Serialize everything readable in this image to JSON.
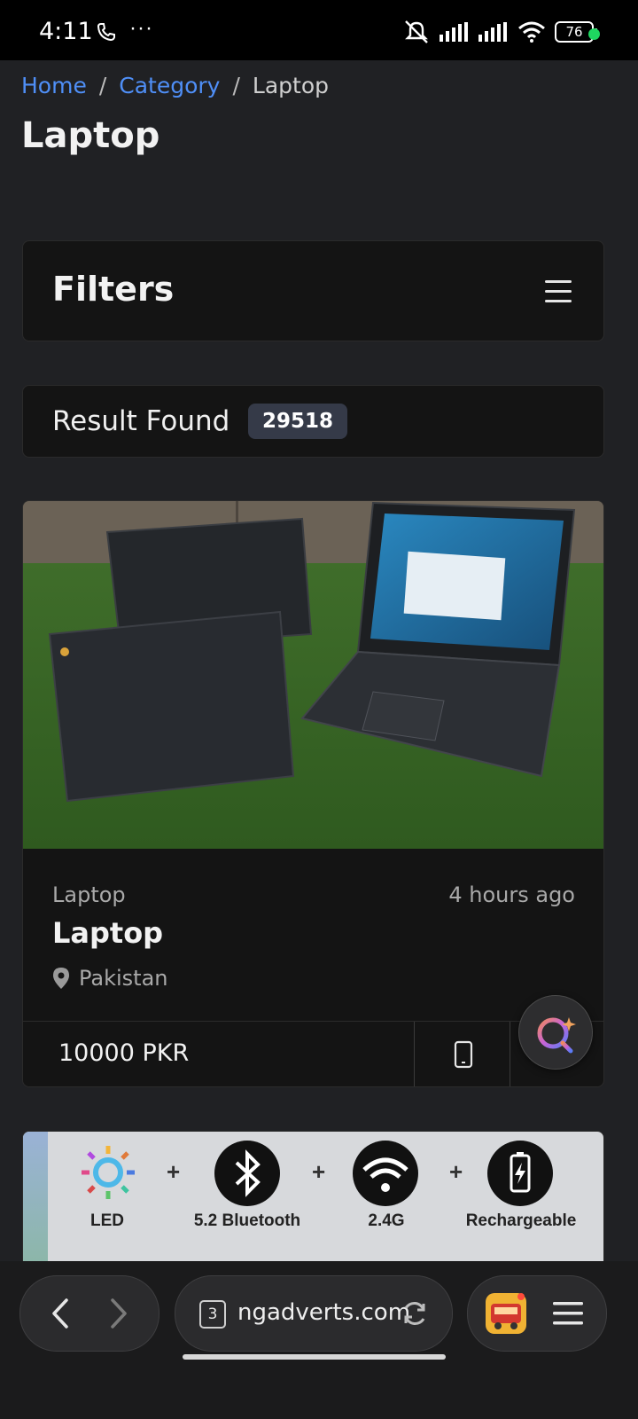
{
  "status_bar": {
    "time": "4:11",
    "more": "···",
    "battery_level": "76"
  },
  "breadcrumb": {
    "items": [
      "Home",
      "Category",
      "Laptop"
    ],
    "separator": "/"
  },
  "page": {
    "title": "Laptop"
  },
  "filters": {
    "title": "Filters"
  },
  "results": {
    "label": "Result Found",
    "count": "29518"
  },
  "listing": {
    "category": "Laptop",
    "posted": "4 hours ago",
    "title": "Laptop",
    "location": "Pakistan",
    "price": "10000 PKR"
  },
  "listing2": {
    "features": [
      "LED",
      "5.2 Bluetooth",
      "2.4G",
      "Rechargeable"
    ],
    "joiner": "+"
  },
  "browser": {
    "tab_count": "3",
    "url": "ngadverts.com"
  },
  "colors": {
    "link": "#4f8ff7",
    "badge_bg": "#353a48",
    "page_bg": "#202124",
    "card_bg": "#141414"
  }
}
